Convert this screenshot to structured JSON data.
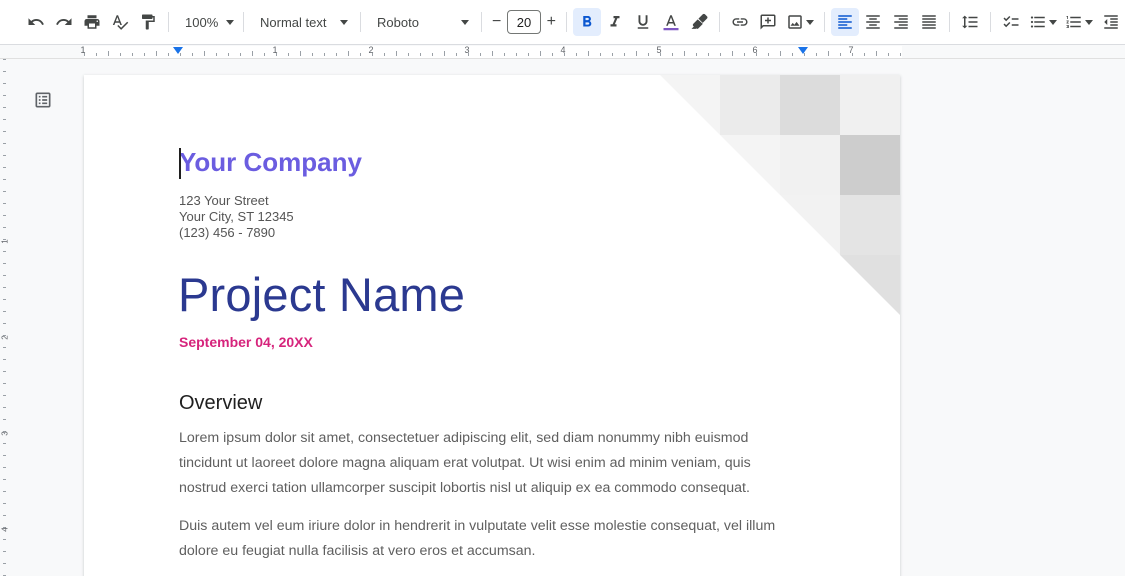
{
  "toolbar": {
    "zoom": "100%",
    "style": "Normal text",
    "font": "Roboto",
    "font_size": "20",
    "minus": "−",
    "plus": "+"
  },
  "ruler": {
    "numbers": [
      "1",
      "1",
      "2",
      "3",
      "4",
      "5",
      "6",
      "7"
    ]
  },
  "vruler": {
    "numbers": [
      "1",
      "2",
      "3",
      "4"
    ]
  },
  "document": {
    "company": "Your Company",
    "address": [
      "123 Your Street",
      "Your City, ST 12345",
      "(123) 456 - 7890"
    ],
    "project": "Project Name",
    "date": "September 04, 20XX",
    "overview_heading": "Overview",
    "paragraphs": [
      [
        "Lorem ipsum dolor sit amet, consectetuer adipiscing elit, sed diam nonummy nibh euismod",
        "tincidunt ut laoreet dolore magna aliquam erat volutpat. Ut wisi enim ad minim veniam, quis",
        "nostrud exerci tation ullamcorper suscipit lobortis nisl ut aliquip ex ea commodo consequat."
      ],
      [
        "Duis autem vel eum iriure dolor in hendrerit in vulputate velit esse molestie consequat, vel illum",
        "dolore eu feugiat nulla facilisis at vero eros et accumsan."
      ]
    ]
  },
  "colors": {
    "company": "#6b5de0",
    "project": "#2b3990",
    "date": "#d6247c",
    "text_color_underline": "#7e57c2"
  }
}
